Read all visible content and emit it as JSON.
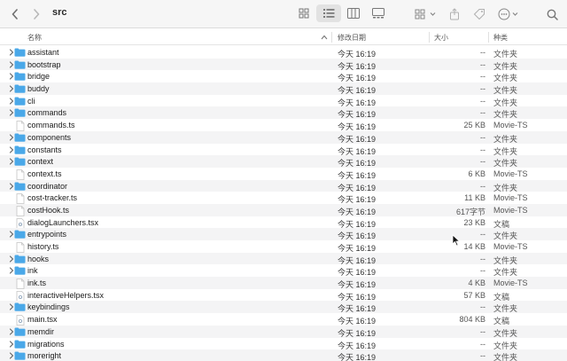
{
  "window": {
    "title": "src"
  },
  "toolbar": {
    "back_icon": "chevron-left-icon",
    "forward_icon": "chevron-right-icon",
    "views": [
      "icon-view-icon",
      "list-view-icon",
      "column-view-icon",
      "gallery-view-icon"
    ],
    "active_view": "list-view-icon",
    "group_icon": "group-by-icon",
    "share_icon": "share-icon",
    "tag_icon": "tag-icon",
    "action_icon": "more-actions-icon",
    "search_icon": "search-icon"
  },
  "columns": {
    "name": "名称",
    "date": "修改日期",
    "size": "大小",
    "kind": "种类"
  },
  "files": [
    {
      "name": "assistant",
      "type": "folder",
      "date": "今天 16:19",
      "size": "--",
      "kind": "文件夹"
    },
    {
      "name": "bootstrap",
      "type": "folder",
      "date": "今天 16:19",
      "size": "--",
      "kind": "文件夹"
    },
    {
      "name": "bridge",
      "type": "folder",
      "date": "今天 16:19",
      "size": "--",
      "kind": "文件夹"
    },
    {
      "name": "buddy",
      "type": "folder",
      "date": "今天 16:19",
      "size": "--",
      "kind": "文件夹"
    },
    {
      "name": "cli",
      "type": "folder",
      "date": "今天 16:19",
      "size": "--",
      "kind": "文件夹"
    },
    {
      "name": "commands",
      "type": "folder",
      "date": "今天 16:19",
      "size": "--",
      "kind": "文件夹"
    },
    {
      "name": "commands.ts",
      "type": "file",
      "date": "今天 16:19",
      "size": "25 KB",
      "kind": "Movie-TS"
    },
    {
      "name": "components",
      "type": "folder",
      "date": "今天 16:19",
      "size": "--",
      "kind": "文件夹"
    },
    {
      "name": "constants",
      "type": "folder",
      "date": "今天 16:19",
      "size": "--",
      "kind": "文件夹"
    },
    {
      "name": "context",
      "type": "folder",
      "date": "今天 16:19",
      "size": "--",
      "kind": "文件夹"
    },
    {
      "name": "context.ts",
      "type": "file",
      "date": "今天 16:19",
      "size": "6 KB",
      "kind": "Movie-TS"
    },
    {
      "name": "coordinator",
      "type": "folder",
      "date": "今天 16:19",
      "size": "--",
      "kind": "文件夹"
    },
    {
      "name": "cost-tracker.ts",
      "type": "file",
      "date": "今天 16:19",
      "size": "11 KB",
      "kind": "Movie-TS"
    },
    {
      "name": "costHook.ts",
      "type": "file",
      "date": "今天 16:19",
      "size": "617字节",
      "kind": "Movie-TS"
    },
    {
      "name": "dialogLaunchers.tsx",
      "type": "doc",
      "date": "今天 16:19",
      "size": "23 KB",
      "kind": "文稿"
    },
    {
      "name": "entrypoints",
      "type": "folder",
      "date": "今天 16:19",
      "size": "--",
      "kind": "文件夹"
    },
    {
      "name": "history.ts",
      "type": "file",
      "date": "今天 16:19",
      "size": "14 KB",
      "kind": "Movie-TS"
    },
    {
      "name": "hooks",
      "type": "folder",
      "date": "今天 16:19",
      "size": "--",
      "kind": "文件夹"
    },
    {
      "name": "ink",
      "type": "folder",
      "date": "今天 16:19",
      "size": "--",
      "kind": "文件夹"
    },
    {
      "name": "ink.ts",
      "type": "file",
      "date": "今天 16:19",
      "size": "4 KB",
      "kind": "Movie-TS"
    },
    {
      "name": "interactiveHelpers.tsx",
      "type": "doc",
      "date": "今天 16:19",
      "size": "57 KB",
      "kind": "文稿"
    },
    {
      "name": "keybindings",
      "type": "folder",
      "date": "今天 16:19",
      "size": "--",
      "kind": "文件夹"
    },
    {
      "name": "main.tsx",
      "type": "doc",
      "date": "今天 16:19",
      "size": "804 KB",
      "kind": "文稿"
    },
    {
      "name": "memdir",
      "type": "folder",
      "date": "今天 16:19",
      "size": "--",
      "kind": "文件夹"
    },
    {
      "name": "migrations",
      "type": "folder",
      "date": "今天 16:19",
      "size": "--",
      "kind": "文件夹"
    },
    {
      "name": "moreright",
      "type": "folder",
      "date": "今天 16:19",
      "size": "--",
      "kind": "文件夹"
    }
  ],
  "colors": {
    "folder": "#4aa8e8",
    "alt_row": "#f4f4f5",
    "toolbar": "#f6f6f6"
  }
}
